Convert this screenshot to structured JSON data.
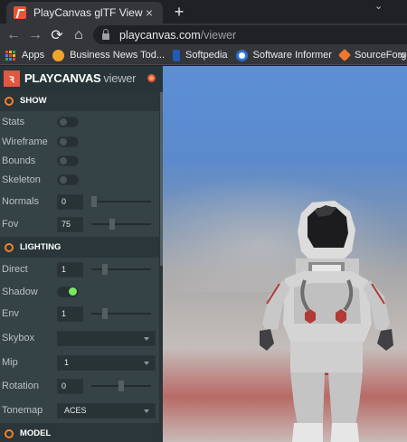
{
  "browser": {
    "tab_title": "PlayCanvas glTF Viewer",
    "tab_close": "×",
    "new_tab": "+",
    "tab_menu": "⌄",
    "url_host": "playcanvas.com",
    "url_path": "/viewer",
    "bookmarks": [
      {
        "label": "Apps",
        "icon": "apps-grid-icon"
      },
      {
        "label": "Business News Tod...",
        "icon": "business-news-icon",
        "color": "#f0a52c"
      },
      {
        "label": "Softpedia",
        "icon": "softpedia-icon",
        "color": "#1f5cb6"
      },
      {
        "label": "Software Informer",
        "icon": "software-informer-icon",
        "color": "#2b6fd3"
      },
      {
        "label": "SourceForge",
        "icon": "sourceforge-icon",
        "color": "#f2772d"
      }
    ],
    "bookmarks_more": "»"
  },
  "panel": {
    "brand": "PLAYCANVAS",
    "brand_sub": "viewer",
    "sections": {
      "show": "SHOW",
      "lighting": "LIGHTING",
      "model": "MODEL"
    },
    "show": {
      "stats": {
        "label": "Stats",
        "on": false
      },
      "wireframe": {
        "label": "Wireframe",
        "on": false
      },
      "bounds": {
        "label": "Bounds",
        "on": false
      },
      "skeleton": {
        "label": "Skeleton",
        "on": false
      },
      "normals": {
        "label": "Normals",
        "value": "0",
        "slider": 0.0
      },
      "fov": {
        "label": "Fov",
        "value": "75",
        "slider": 0.33
      }
    },
    "lighting": {
      "direct": {
        "label": "Direct",
        "value": "1",
        "slider": 0.2
      },
      "shadow": {
        "label": "Shadow",
        "on": true
      },
      "env": {
        "label": "Env",
        "value": "1",
        "slider": 0.2
      },
      "skybox": {
        "label": "Skybox",
        "value": ""
      },
      "mip": {
        "label": "Mip",
        "value": "1"
      },
      "rotation": {
        "label": "Rotation",
        "value": "0",
        "slider": 0.5
      },
      "tonemap": {
        "label": "Tonemap",
        "value": "ACES"
      }
    }
  },
  "colors": {
    "accent": "#e1573f",
    "toggle_on": "#7be85b"
  }
}
